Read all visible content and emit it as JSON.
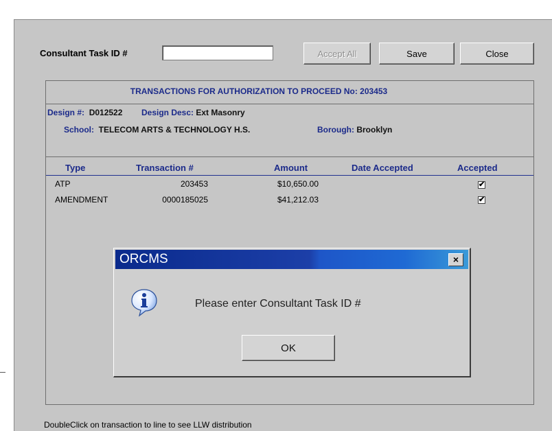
{
  "toolbar": {
    "task_label": "Consultant Task ID #",
    "task_value": "",
    "accept_all_label": "Accept All",
    "save_label": "Save",
    "close_label": "Close"
  },
  "panel": {
    "title": "TRANSACTIONS FOR AUTHORIZATION TO PROCEED No: 203453",
    "design_no_label": "Design #:",
    "design_no_value": "D012522",
    "design_desc_label": "Design Desc:",
    "design_desc_value": "Ext Masonry",
    "school_label": "School:",
    "school_value": "TELECOM ARTS & TECHNOLOGY H.S.",
    "borough_label": "Borough:",
    "borough_value": "Brooklyn"
  },
  "table": {
    "columns": [
      "Type",
      "Transaction #",
      "Amount",
      "Date Accepted",
      "Accepted"
    ],
    "rows": [
      {
        "type": "ATP",
        "transaction": "203453",
        "amount": "$10,650.00",
        "date_accepted": "",
        "accepted": true
      },
      {
        "type": "AMENDMENT",
        "transaction": "0000185025",
        "amount": "$41,212.03",
        "date_accepted": "",
        "accepted": true
      }
    ]
  },
  "footer": {
    "hint": "DoubleClick on transaction to line to see LLW distribution"
  },
  "dialog": {
    "title": "ORCMS",
    "message": "Please enter Consultant Task ID #",
    "ok_label": "OK",
    "close_glyph": "×",
    "icon": "info-icon"
  },
  "check_glyph": "✔"
}
